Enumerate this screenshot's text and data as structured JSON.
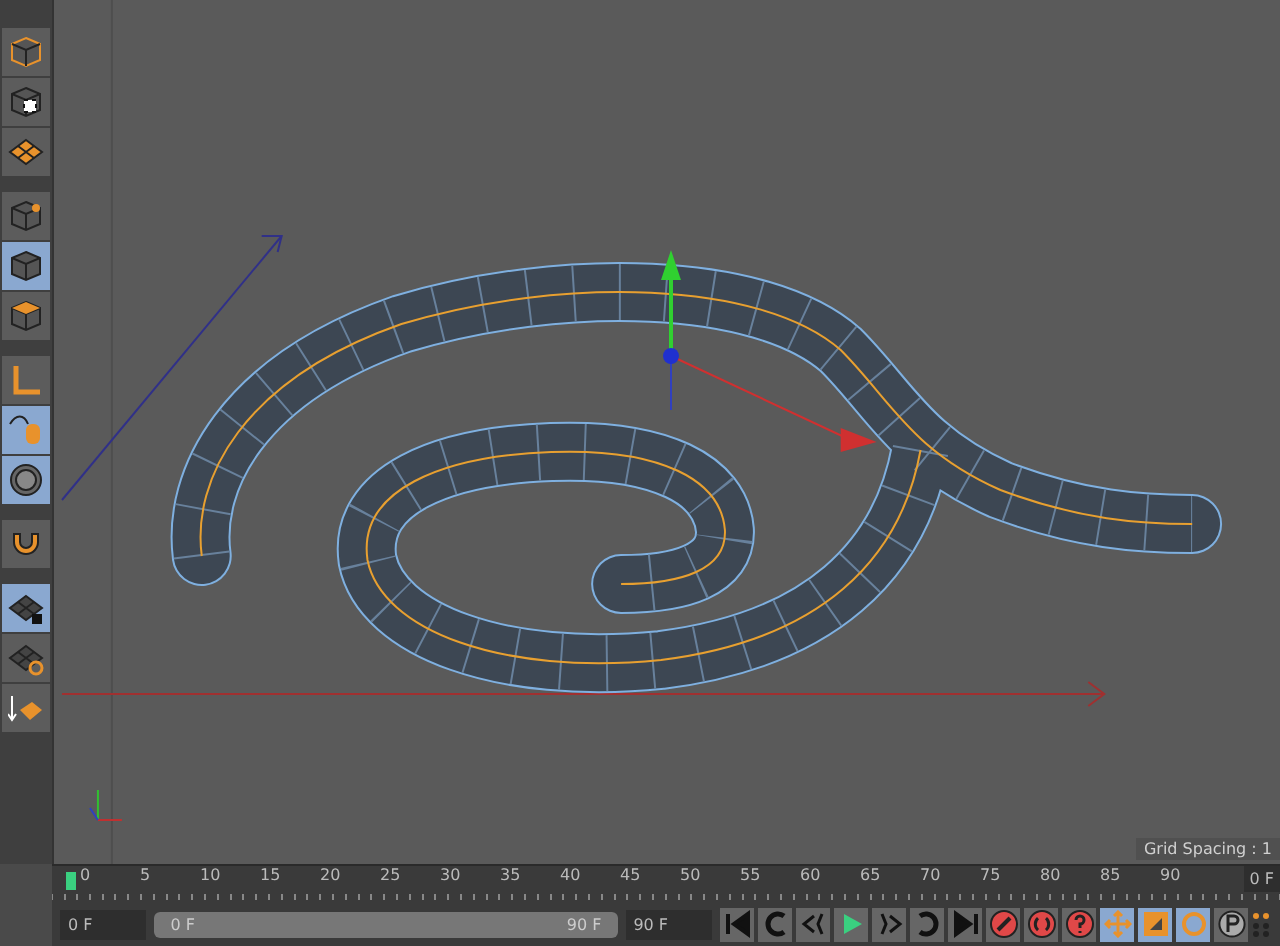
{
  "toolbar": {
    "groups": [
      {
        "tools": [
          {
            "kind": "model",
            "selected": false
          },
          {
            "kind": "texture",
            "selected": false
          },
          {
            "kind": "workplane",
            "selected": false
          }
        ]
      },
      {
        "tools": [
          {
            "kind": "points",
            "selected": false
          },
          {
            "kind": "edges",
            "selected": true
          },
          {
            "kind": "polygons",
            "selected": false
          }
        ]
      },
      {
        "tools": [
          {
            "kind": "axis",
            "selected": false
          },
          {
            "kind": "tweak",
            "selected": true
          },
          {
            "kind": "solo",
            "selected": true
          }
        ]
      },
      {
        "tools": [
          {
            "kind": "snap",
            "selected": false
          }
        ]
      },
      {
        "tools": [
          {
            "kind": "lock",
            "selected": true
          },
          {
            "kind": "planar",
            "selected": false
          },
          {
            "kind": "arrange",
            "selected": false
          }
        ]
      }
    ]
  },
  "viewport": {
    "grid_spacing": "Grid Spacing : 1"
  },
  "timeline": {
    "ticks": [
      "0",
      "5",
      "10",
      "15",
      "20",
      "25",
      "30",
      "35",
      "40",
      "45",
      "50",
      "55",
      "60",
      "65",
      "70",
      "75",
      "80",
      "85",
      "90"
    ],
    "current_frame": "0 F"
  },
  "controls": {
    "start_field": "0 F",
    "range": {
      "level": 1,
      "start": "0 F",
      "end": "90 F"
    },
    "end_field": "90 F",
    "transport": [
      {
        "kind": "first"
      },
      {
        "kind": "prevkey"
      },
      {
        "kind": "prev"
      },
      {
        "kind": "play"
      },
      {
        "kind": "next"
      },
      {
        "kind": "nextkey"
      },
      {
        "kind": "last"
      }
    ],
    "record": [
      {
        "kind": "record"
      },
      {
        "kind": "autokey"
      },
      {
        "kind": "keyhelp"
      }
    ],
    "modes": [
      {
        "kind": "move",
        "selected": true
      },
      {
        "kind": "scale",
        "selected": true
      },
      {
        "kind": "rotate",
        "selected": true
      },
      {
        "kind": "param",
        "selected": false
      }
    ]
  }
}
